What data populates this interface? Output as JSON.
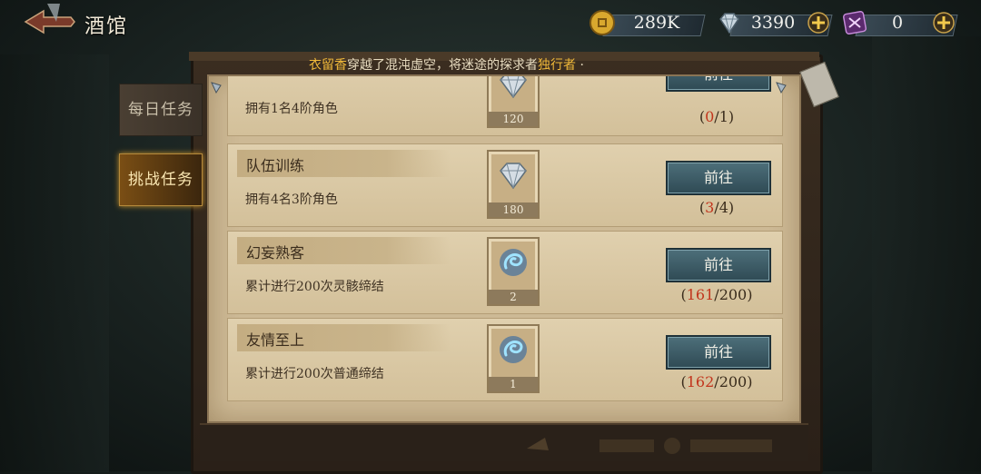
{
  "header": {
    "title": "酒馆"
  },
  "currencies": [
    {
      "name": "coin",
      "icon": "gold-coin-icon",
      "value": "289K",
      "has_plus": true
    },
    {
      "name": "diamond",
      "icon": "diamond-icon",
      "value": "3390",
      "has_plus": true
    },
    {
      "name": "crystal",
      "icon": "purple-crystal-icon",
      "value": "0",
      "has_plus": true
    }
  ],
  "marquee": {
    "highlight_1": "衣留香",
    "text": "穿越了混沌虚空，将迷途的探求者",
    "highlight_2": "独行者",
    "tail": "·"
  },
  "tabs": [
    {
      "label": "每日任务",
      "active": false
    },
    {
      "label": "挑战任务",
      "active": true
    }
  ],
  "tasks": [
    {
      "name": "",
      "desc": "拥有1名4阶角色",
      "reward_icon": "diamond-icon",
      "reward_count": "120",
      "button": "前往",
      "progress_current": "0",
      "progress_total": "1"
    },
    {
      "name": "队伍训练",
      "desc": "拥有4名3阶角色",
      "reward_icon": "diamond-icon",
      "reward_count": "180",
      "button": "前往",
      "progress_current": "3",
      "progress_total": "4"
    },
    {
      "name": "幻妄熟客",
      "desc": "累计进行200次灵骸缔结",
      "reward_icon": "blue-swirl-icon",
      "reward_count": "2",
      "button": "前往",
      "progress_current": "161",
      "progress_total": "200"
    },
    {
      "name": "友情至上",
      "desc": "累计进行200次普通缔结",
      "reward_icon": "blue-swirl-icon",
      "reward_count": "1",
      "button": "前往",
      "progress_current": "162",
      "progress_total": "200"
    }
  ],
  "colors": {
    "accent_gold": "#f0b93a",
    "progress_red": "#c2341c",
    "button_teal": "#3b5b66",
    "paper": "#cdb995"
  }
}
